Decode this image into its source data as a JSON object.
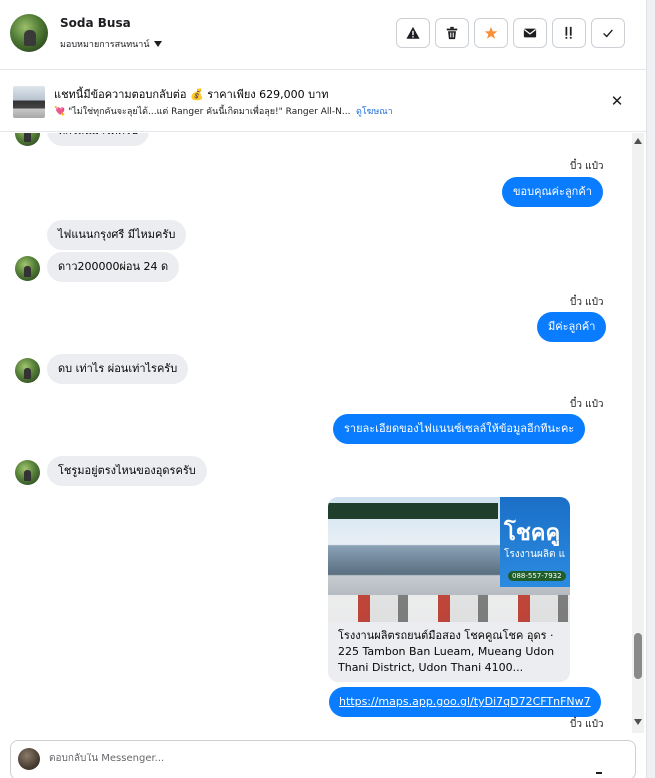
{
  "header": {
    "name": "Soda Busa",
    "assign_label": "มอบหมายการสนทนาน์",
    "actions": [
      {
        "name": "report-button",
        "icon": "warning-icon"
      },
      {
        "name": "delete-button",
        "icon": "trash-icon"
      },
      {
        "name": "star-button",
        "icon": "star-icon"
      },
      {
        "name": "mark-unread-button",
        "icon": "envelope-icon"
      },
      {
        "name": "follow-up-button",
        "icon": "flag-icon"
      },
      {
        "name": "done-button",
        "icon": "check-icon"
      }
    ]
  },
  "ad": {
    "title": "แชทนี้มีข้อความตอบกลับต่อ 💰 ราคาเพียง 629,000 บาท",
    "subtitle": "💘 \"ไม่ใช่ทุกคันจะลุยได้...แต่ Ranger คันนี้เกิดมาเพื่อลุย!\" Ranger All-N...",
    "link": "ดูโฆษณา"
  },
  "messages": {
    "partial_top": "ทักไลน์มาได้ครับ",
    "seen_1": "บี๋ว แป๋ว",
    "out_1": "ขอบคุณค่ะลูกค้า",
    "in_1a": "ไฟแนนกรุงศรี มีไหมครับ",
    "in_1b": "ดาว200000ผ่อน 24 ด",
    "seen_2": "บี๋ว แป๋ว",
    "out_2": "มีค่ะลูกค้า",
    "in_2": "ดบ เท่าไร ผ่อนเท่าไรครับ",
    "seen_3": "บี๋ว แป๋ว",
    "out_3": "รายละเอียดของไฟแนนซ์เซลล์ให้ข้อมูลอีกทีนะคะ",
    "in_3": "โชรูมอยู่ตรงไหนของอุดรครับ",
    "card_sign": "โชคคู",
    "card_sign_sub": "โรงงานผลิต แ",
    "card_phone": "088-557-7932",
    "card_text": "โรงงานผลิตรถยนต์มือสอง โชคคูณโชค อุดร · 225 Tambon Ban Lueam, Mueang Udon Thani District, Udon Thani 4100...",
    "link_text": "https://maps.app.goo.gl/tyDi7qD72CFTnFNw7",
    "seen_4": "บี๋ว แป๋ว"
  },
  "composer": {
    "placeholder": "ตอบกลับใน Messenger..."
  },
  "colors": {
    "accent": "#0a7cff",
    "bubble_in": "#ebedf0",
    "star": "#f7923a"
  }
}
